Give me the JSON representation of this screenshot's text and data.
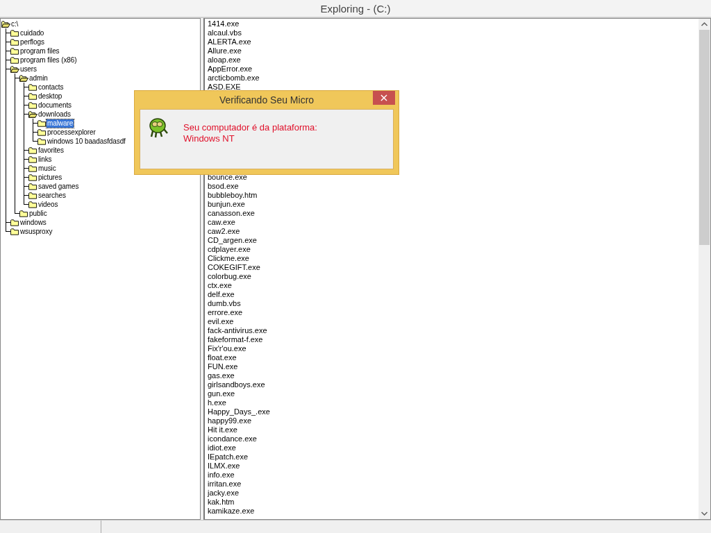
{
  "window": {
    "title": "Exploring - (C:)"
  },
  "tree": {
    "label": "c:\\",
    "expanded": true,
    "selected": false,
    "children": [
      {
        "label": "cuidado",
        "expanded": false,
        "selected": false
      },
      {
        "label": "perflogs",
        "expanded": false,
        "selected": false
      },
      {
        "label": "program files",
        "expanded": false,
        "selected": false
      },
      {
        "label": "program files (x86)",
        "expanded": false,
        "selected": false
      },
      {
        "label": "users",
        "expanded": true,
        "selected": false,
        "children": [
          {
            "label": "admin",
            "expanded": true,
            "selected": false,
            "children": [
              {
                "label": "contacts",
                "expanded": false,
                "selected": false
              },
              {
                "label": "desktop",
                "expanded": false,
                "selected": false
              },
              {
                "label": "documents",
                "expanded": false,
                "selected": false
              },
              {
                "label": "downloads",
                "expanded": true,
                "selected": false,
                "children": [
                  {
                    "label": "malware",
                    "expanded": false,
                    "selected": true
                  },
                  {
                    "label": "processexplorer",
                    "expanded": false,
                    "selected": false
                  },
                  {
                    "label": "windows 10 baadasfdasdf",
                    "expanded": false,
                    "selected": false
                  }
                ]
              },
              {
                "label": "favorites",
                "expanded": false,
                "selected": false
              },
              {
                "label": "links",
                "expanded": false,
                "selected": false
              },
              {
                "label": "music",
                "expanded": false,
                "selected": false
              },
              {
                "label": "pictures",
                "expanded": false,
                "selected": false
              },
              {
                "label": "saved games",
                "expanded": false,
                "selected": false
              },
              {
                "label": "searches",
                "expanded": false,
                "selected": false
              },
              {
                "label": "videos",
                "expanded": false,
                "selected": false
              }
            ]
          },
          {
            "label": "public",
            "expanded": false,
            "selected": false
          }
        ]
      },
      {
        "label": "windows",
        "expanded": false,
        "selected": false
      },
      {
        "label": "wsusproxy",
        "expanded": false,
        "selected": false
      }
    ]
  },
  "file_list": {
    "items_above_dialog": [
      "1414.exe",
      "alcaul.vbs",
      "ALERTA.exe",
      "Allure.exe",
      "aloap.exe",
      "AppError.exe",
      "arcticbomb.exe",
      "ASD.EXE"
    ],
    "items_below_dialog": [
      "bounce.exe",
      "bsod.exe",
      "bubbleboy.htm",
      "bunjun.exe",
      "canasson.exe",
      "caw.exe",
      "caw2.exe",
      "CD_argen.exe",
      "cdplayer.exe",
      "Clickme.exe",
      "COKEGIFT.exe",
      "colorbug.exe",
      "ctx.exe",
      "delf.exe",
      "dumb.vbs",
      "errore.exe",
      "evil.exe",
      "fack-antivirus.exe",
      "fakeformat-f.exe",
      "Fix'r'ou.exe",
      "float.exe",
      "FUN.exe",
      "gas.exe",
      "girlsandboys.exe",
      "gun.exe",
      "h.exe",
      "Happy_Days_.exe",
      "happy99.exe",
      "Hit it.exe",
      "icondance.exe",
      "idiot.exe",
      "IEpatch.exe",
      "ILMX.exe",
      "info.exe",
      "irritan.exe",
      "jacky.exe",
      "kak.htm",
      "kamikaze.exe"
    ]
  },
  "dialog": {
    "title": "Verificando Seu Micro",
    "close": "×",
    "message_lines": [
      "Seu computador é da plataforma:",
      "Windows NT"
    ]
  }
}
